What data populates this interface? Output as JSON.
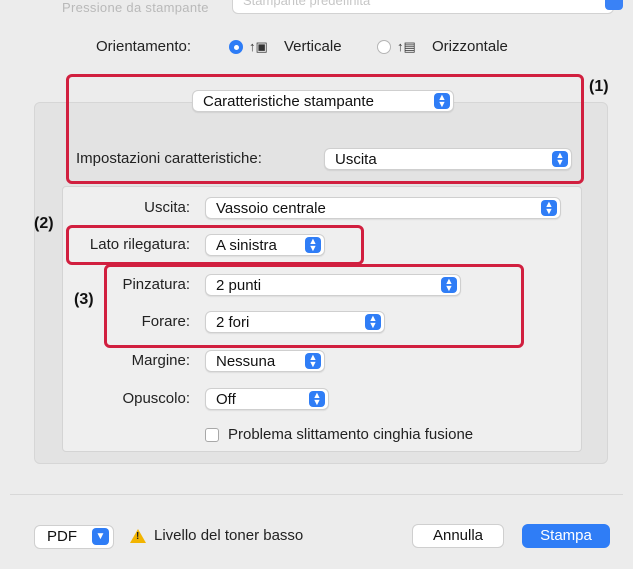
{
  "top_row": {
    "label": "Pressione da stampante",
    "value": "Stampante predefinita"
  },
  "orientation": {
    "label": "Orientamento:",
    "portrait_label": "Verticale",
    "landscape_label": "Orizzontale",
    "selected": "Verticale"
  },
  "features_popup": {
    "value": "Caratteristiche stampante"
  },
  "feature_settings": {
    "label": "Impostazioni caratteristiche:",
    "value": "Uscita"
  },
  "fields": {
    "uscita": {
      "label": "Uscita:",
      "value": "Vassoio centrale"
    },
    "lato_rilegatura": {
      "label": "Lato rilegatura:",
      "value": "A sinistra"
    },
    "pinzatura": {
      "label": "Pinzatura:",
      "value": "2 punti"
    },
    "forare": {
      "label": "Forare:",
      "value": "2 fori"
    },
    "margine": {
      "label": "Margine:",
      "value": "Nessuna"
    },
    "opuscolo": {
      "label": "Opuscolo:",
      "value": "Off"
    }
  },
  "fuser_checkbox": {
    "label": "Problema slittamento cinghia fusione",
    "checked": false
  },
  "callouts": {
    "one": "(1)",
    "two": "(2)",
    "three": "(3)"
  },
  "footer": {
    "pdf_label": "PDF",
    "warning_text": "Livello del toner basso",
    "cancel_label": "Annulla",
    "print_label": "Stampa"
  },
  "colors": {
    "accent": "#2f7df6",
    "callout": "#d11f3f",
    "warning": "#f2b400"
  },
  "icons": {
    "portrait": "portrait-orientation-icon",
    "landscape": "landscape-orientation-icon",
    "popup_arrows": "up-down-chevron-icon",
    "pdf_menu": "chevron-down-icon",
    "warning": "warning-triangle-icon"
  }
}
